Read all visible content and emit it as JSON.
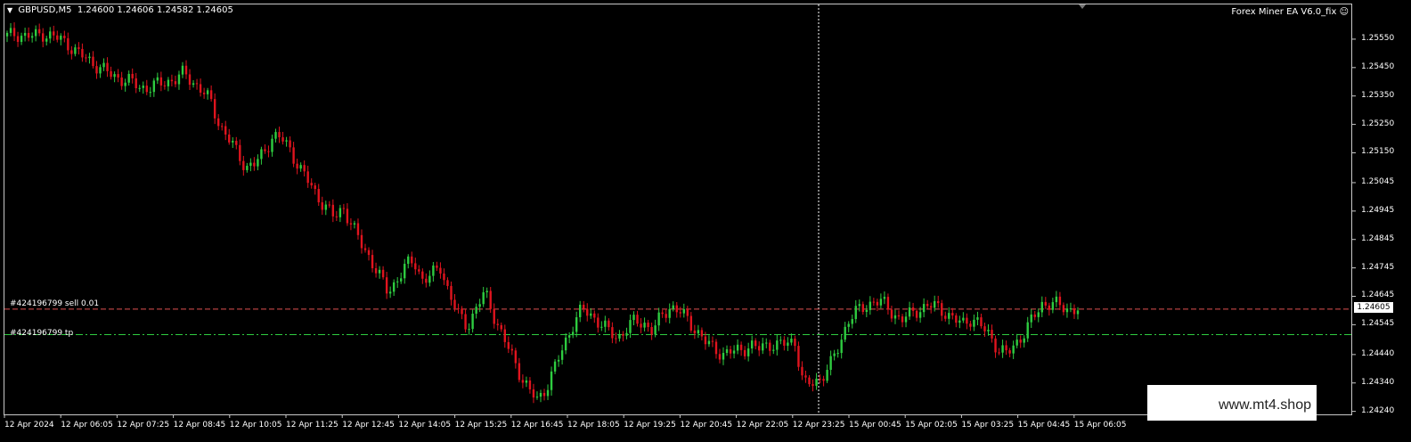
{
  "ticker": {
    "symbol_tf": "GBPUSD,M5",
    "ohlc": "1.24600 1.24606 1.24582 1.24605"
  },
  "ea": {
    "label": "Forex Miner EA  V6.0_fix"
  },
  "orders": [
    {
      "label": "#424196799 sell 0.01",
      "price": 1.246,
      "color": "#e05050",
      "style": "dashed"
    },
    {
      "label": "#424196799 tp",
      "price": 1.2451,
      "color": "#2ecc40",
      "style": "dashdot"
    }
  ],
  "current_price": "1.24605",
  "price_axis": [
    "1.25550",
    "1.25450",
    "1.25350",
    "1.25250",
    "1.25150",
    "1.25045",
    "1.24945",
    "1.24845",
    "1.24745",
    "1.24645",
    "1.24545",
    "1.24440",
    "1.24340",
    "1.24240"
  ],
  "time_axis": [
    "12 Apr 2024",
    "12 Apr 06:05",
    "12 Apr 07:25",
    "12 Apr 08:45",
    "12 Apr 10:05",
    "12 Apr 11:25",
    "12 Apr 12:45",
    "12 Apr 14:05",
    "12 Apr 15:25",
    "12 Apr 16:45",
    "12 Apr 18:05",
    "12 Apr 19:25",
    "12 Apr 20:45",
    "12 Apr 22:05",
    "12 Apr 23:25",
    "15 Apr 00:45",
    "15 Apr 02:05",
    "15 Apr 03:25",
    "15 Apr 04:45",
    "15 Apr 06:05"
  ],
  "watermark": "www.mt4.shop",
  "colors": {
    "bull": "#2ecc40",
    "bear": "#e0141e",
    "grid": "#c8c8c8",
    "crosshair": "#ffffff"
  },
  "chart_data": {
    "type": "candlestick",
    "ylim": [
      1.2422,
      1.256
    ],
    "series": [
      {
        "close_path": [
          1.2556,
          1.2557,
          1.2556,
          1.2556,
          1.2557,
          1.2556,
          1.2555,
          1.2553,
          1.255,
          1.2548,
          1.2546,
          1.2544,
          1.2542,
          1.2541,
          1.254,
          1.2538,
          1.2538,
          1.2539,
          1.254,
          1.2541,
          1.2543,
          1.254,
          1.2537,
          1.2533,
          1.2525,
          1.252,
          1.2515,
          1.251,
          1.2511,
          1.2515,
          1.2521,
          1.252,
          1.2516,
          1.251,
          1.2505,
          1.25,
          1.2496,
          1.2492,
          1.2496,
          1.2489,
          1.2483,
          1.2478,
          1.2472,
          1.2466,
          1.247,
          1.2475,
          1.2477,
          1.247,
          1.2472,
          1.2475,
          1.2465,
          1.2458,
          1.2454,
          1.246,
          1.2466,
          1.2458,
          1.245,
          1.2444,
          1.2437,
          1.2431,
          1.2428,
          1.2433,
          1.244,
          1.2448,
          1.2455,
          1.246,
          1.2458,
          1.2455,
          1.2452,
          1.245,
          1.2453,
          1.2456,
          1.2455,
          1.2452,
          1.2458,
          1.2461,
          1.2459,
          1.2456,
          1.2452,
          1.2448,
          1.2446,
          1.2444,
          1.2445,
          1.2446,
          1.2447,
          1.2446,
          1.2448,
          1.2447,
          1.2448,
          1.2449,
          1.2433,
          1.2434,
          1.2436,
          1.244,
          1.2447,
          1.2456,
          1.2459,
          1.2461,
          1.2463,
          1.2462,
          1.2459,
          1.2456,
          1.2458,
          1.246,
          1.2461,
          1.2461,
          1.2459,
          1.2456,
          1.2455,
          1.2457,
          1.2454,
          1.2451,
          1.2446,
          1.2444,
          1.2448,
          1.2452,
          1.2457,
          1.2462,
          1.2462,
          1.2461,
          1.246,
          1.246
        ]
      }
    ]
  }
}
